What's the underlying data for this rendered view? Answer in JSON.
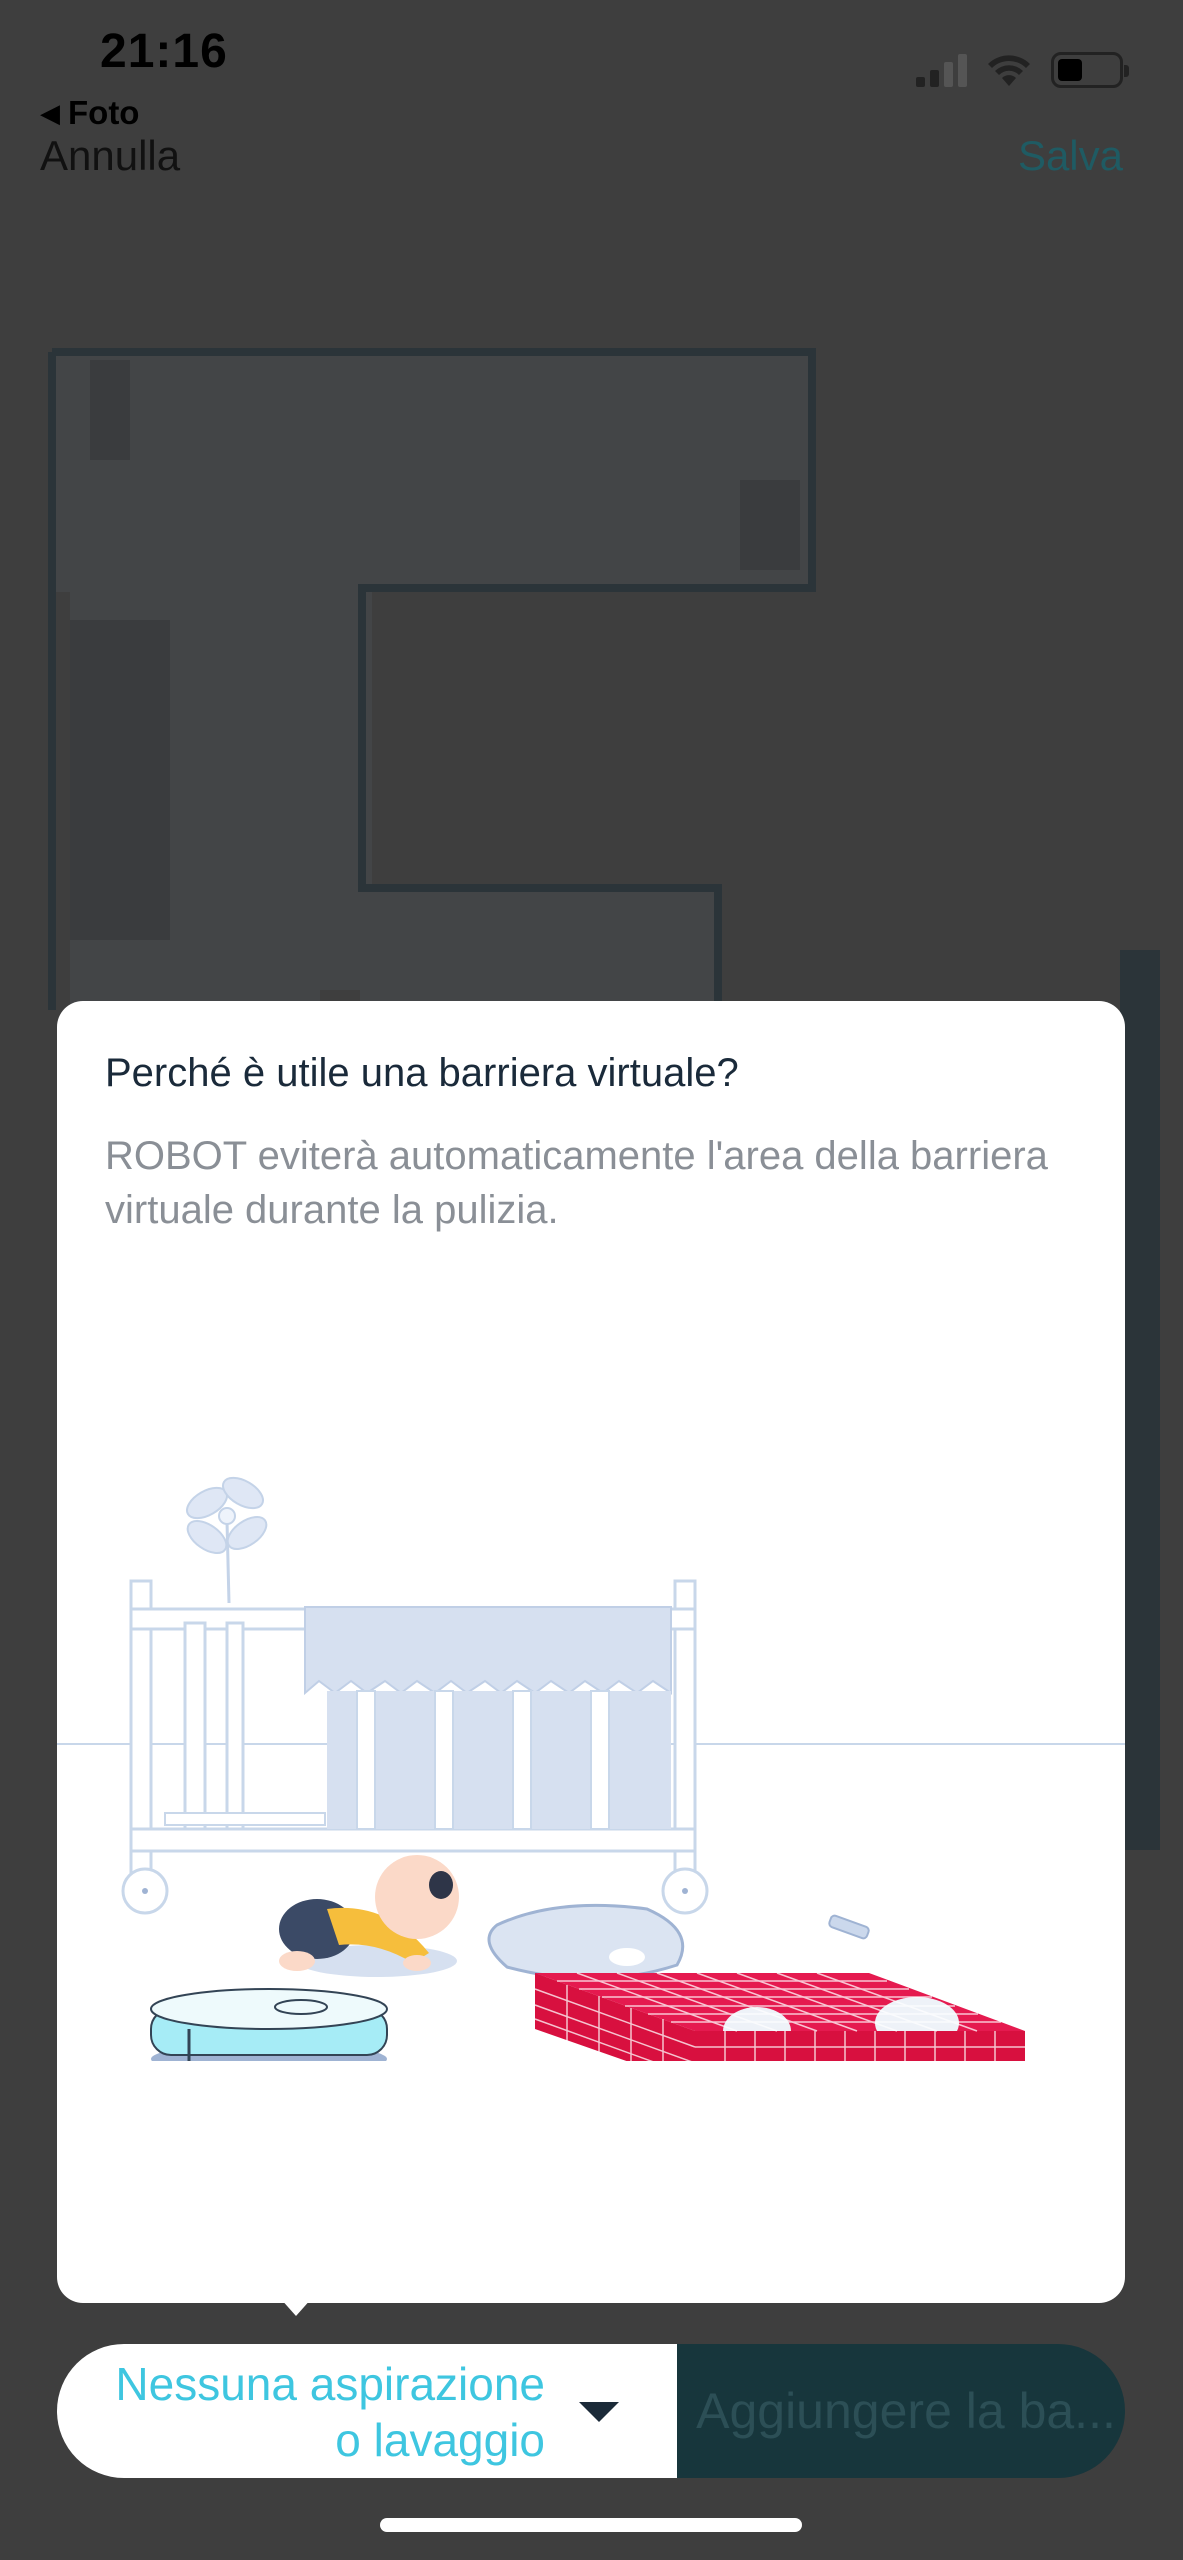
{
  "status_bar": {
    "time": "21:16",
    "back_app": "Foto",
    "icons": [
      "signal-icon",
      "wifi-icon",
      "battery-icon"
    ]
  },
  "nav": {
    "cancel_label": "Annulla",
    "save_label": "Salva"
  },
  "popup": {
    "title": "Perché è utile una barriera virtuale?",
    "description": "ROBOT eviterà automaticamente l'area della barriera virtuale durante la pulizia."
  },
  "bottom_bar": {
    "mode_line1": "Nessuna aspirazione",
    "mode_line2": "o lavaggio",
    "add_button_label": "Aggiungere la ba..."
  },
  "colors": {
    "accent": "#3ec6e0",
    "save_text": "#1f5b63",
    "add_button_bg": "#17363c",
    "overlay": "#3e3e3e",
    "barrier_red": "#d8103f"
  }
}
